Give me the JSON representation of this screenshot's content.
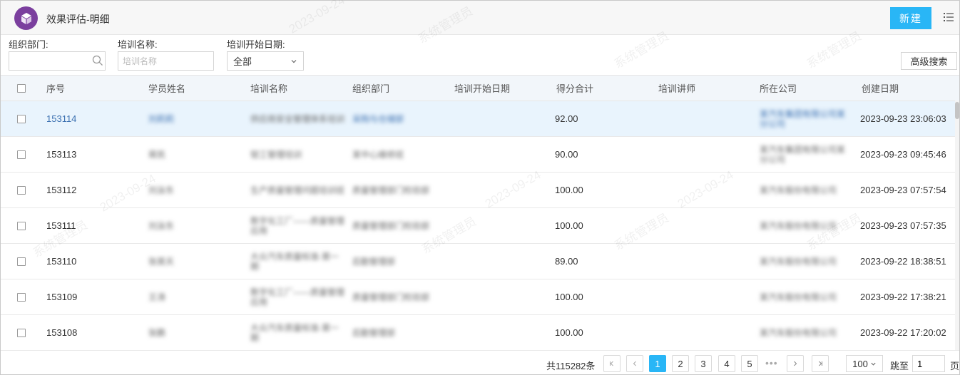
{
  "header": {
    "title": "效果评估-明细",
    "new_button": "新建",
    "colors": {
      "logo": "#7b3f9e",
      "accent": "#29b6f6"
    }
  },
  "filters": {
    "org_label": "组织部门:",
    "org_value": "",
    "training_label": "培训名称:",
    "training_placeholder": "培训名称",
    "date_label": "培训开始日期:",
    "date_value": "全部",
    "advanced_search": "高级搜索"
  },
  "table": {
    "columns": [
      "序号",
      "学员姓名",
      "培训名称",
      "组织部门",
      "培训开始日期",
      "得分合计",
      "培训讲师",
      "所在公司",
      "创建日期"
    ],
    "rows": [
      {
        "id": "153114",
        "name": "刘莉莉",
        "training": "供应商安全管理体系培训",
        "dept": "采购与仓储部",
        "start": "",
        "score": "92.00",
        "teacher": "",
        "company": "某汽车集团有限公司某分公司",
        "created": "2023-09-23 23:06:03",
        "selected": true
      },
      {
        "id": "153113",
        "name": "蒋凯",
        "training": "钳工管理培训",
        "dept": "某中心维修班",
        "start": "",
        "score": "90.00",
        "teacher": "",
        "company": "某汽车集团有限公司某分公司",
        "created": "2023-09-23 09:45:46",
        "selected": false
      },
      {
        "id": "153112",
        "name": "刘泳东",
        "training": "生产质量管理问题培训班",
        "dept": "质量管理部门检验部",
        "start": "",
        "score": "100.00",
        "teacher": "",
        "company": "某汽车股份有限公司",
        "created": "2023-09-23 07:57:54",
        "selected": false
      },
      {
        "id": "153111",
        "name": "刘泳东",
        "training": "数字化工厂——质量管理应用",
        "dept": "质量管理部门检验部",
        "start": "",
        "score": "100.00",
        "teacher": "",
        "company": "某汽车股份有限公司",
        "created": "2023-09-23 07:57:35",
        "selected": false
      },
      {
        "id": "153110",
        "name": "张昊天",
        "training": "大众汽车质量标准-第一期",
        "dept": "后勤管理部",
        "start": "",
        "score": "89.00",
        "teacher": "",
        "company": "某汽车股份有限公司",
        "created": "2023-09-22 18:38:51",
        "selected": false
      },
      {
        "id": "153109",
        "name": "王涛",
        "training": "数字化工厂——质量管理应用",
        "dept": "质量管理部门检验部",
        "start": "",
        "score": "100.00",
        "teacher": "",
        "company": "某汽车股份有限公司",
        "created": "2023-09-22 17:38:21",
        "selected": false
      },
      {
        "id": "153108",
        "name": "张鹏",
        "training": "大众汽车质量标准-第一期",
        "dept": "后勤管理部",
        "start": "",
        "score": "100.00",
        "teacher": "",
        "company": "某汽车股份有限公司",
        "created": "2023-09-22 17:20:02",
        "selected": false
      }
    ]
  },
  "pagination": {
    "total_text": "共115282条",
    "pages": [
      "1",
      "2",
      "3",
      "4",
      "5"
    ],
    "current": "1",
    "ellipsis": "•••",
    "page_size": "100",
    "jump_label": "跳至",
    "jump_value": "1",
    "page_unit": "页"
  },
  "watermark": {
    "text": "系统管理员",
    "date": "2023-09-24"
  }
}
